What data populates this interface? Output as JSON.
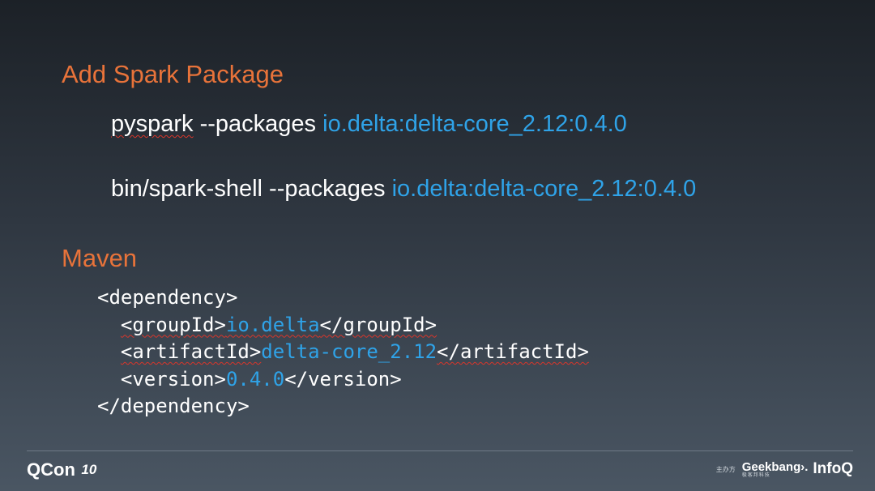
{
  "section1": {
    "heading": "Add Spark Package",
    "commands": [
      {
        "cmd": "pyspark",
        "flag": " --packages ",
        "package": "io.delta:delta-core_2.12:0.4.0"
      },
      {
        "cmd": "bin/spark-shell",
        "flag": " --packages ",
        "package": "io.delta:delta-core_2.12:0.4.0"
      }
    ]
  },
  "section2": {
    "heading": "Maven",
    "code": {
      "open_dependency": "<dependency>",
      "group_open": "<groupId>",
      "group_value": "io.delta",
      "group_close": "</groupId>",
      "artifact_open": "<artifactId>",
      "artifact_value": "delta-core_2.12",
      "artifact_close": "</artifactId>",
      "version_open": "<version>",
      "version_value": "0.4.0",
      "version_close": "</version>",
      "close_dependency": "</dependency>"
    }
  },
  "footer": {
    "left_logo": "QCon",
    "left_badge": "10",
    "host_label": "主办方",
    "geekbang": "Geekbang›.",
    "geekbang_sub": "极客邦科技",
    "infoq": "InfoQ"
  },
  "colors": {
    "heading": "#e8733a",
    "package": "#2fa3e8",
    "text": "#ffffff",
    "spellcheck": "#d9362b"
  }
}
